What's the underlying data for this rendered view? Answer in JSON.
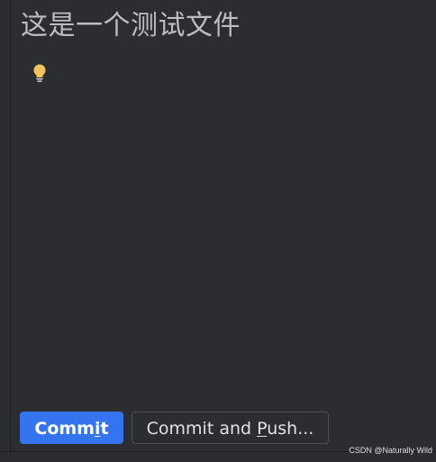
{
  "commit_panel": {
    "message": "这是一个测试文件",
    "hint_icon": "lightbulb-icon",
    "buttons": {
      "commit": {
        "before_mnemonic": "Comm",
        "mnemonic": "i",
        "after_mnemonic": "t"
      },
      "commit_and_push": {
        "before_mnemonic": "Commit and ",
        "mnemonic": "P",
        "after_mnemonic": "ush..."
      }
    }
  },
  "watermark": "CSDN @Naturally Wild",
  "colors": {
    "background": "#2b2d30",
    "primary_button": "#3574f0",
    "secondary_border": "#4e5157",
    "message_text": "#bcbec4",
    "bulb": "#f2c55c"
  }
}
